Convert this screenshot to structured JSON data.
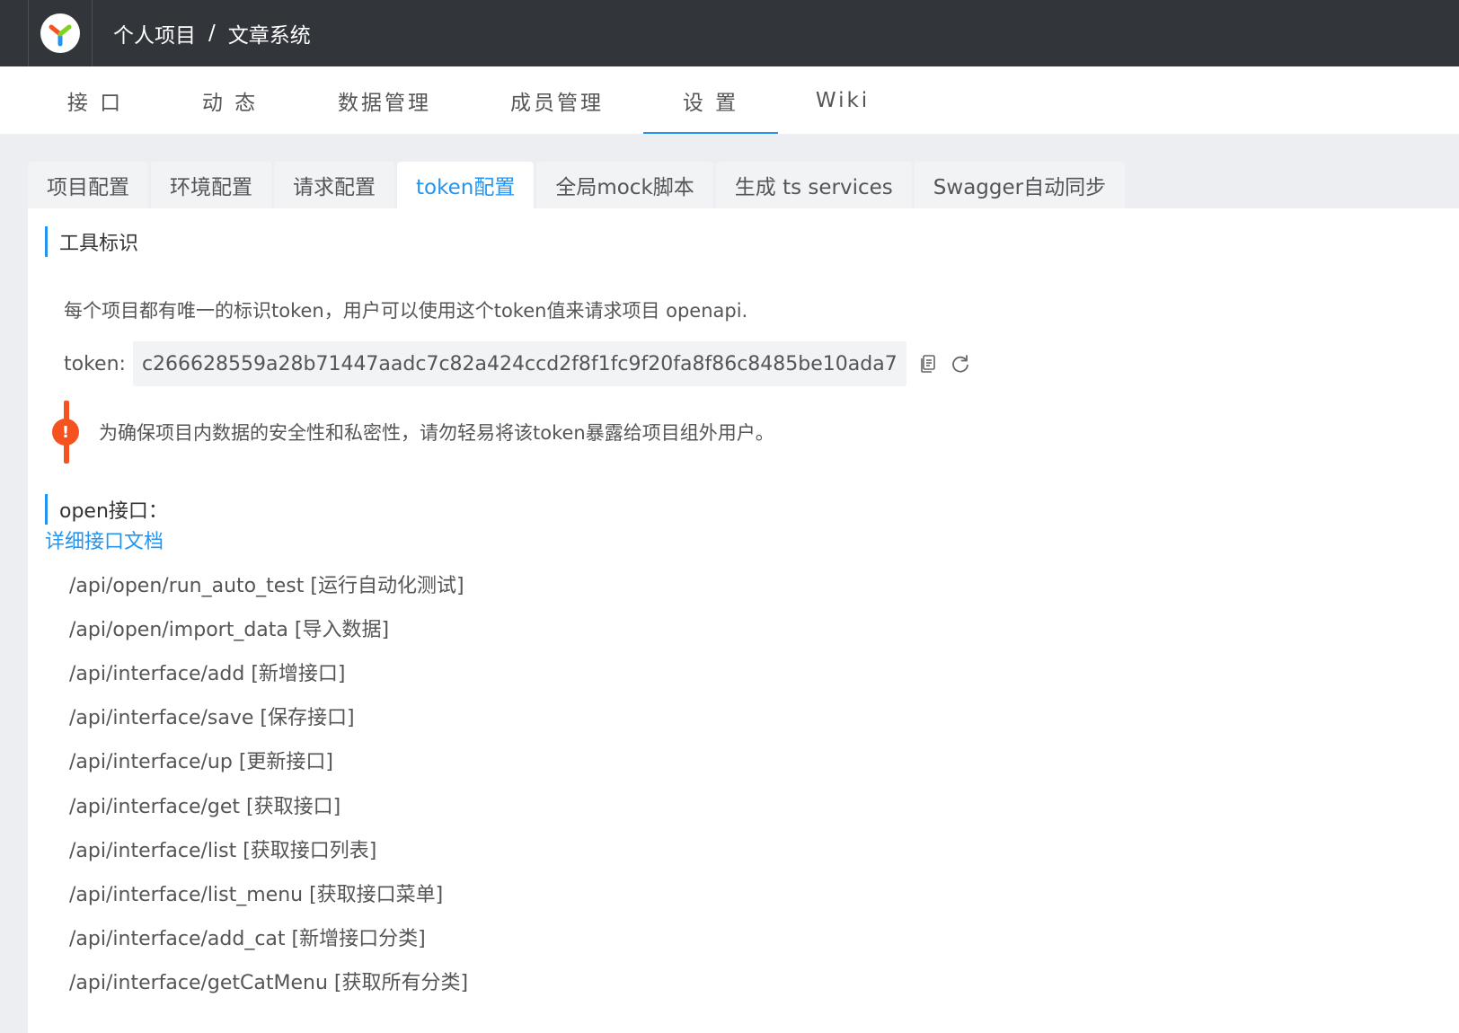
{
  "header": {
    "breadcrumb": [
      "个人项目",
      "/",
      "文章系统"
    ]
  },
  "nav": {
    "items": [
      {
        "label": "接 口"
      },
      {
        "label": "动 态"
      },
      {
        "label": "数据管理"
      },
      {
        "label": "成员管理"
      },
      {
        "label": "设 置"
      },
      {
        "label": "Wiki"
      }
    ],
    "active_index": 4
  },
  "tabs": [
    {
      "label": "项目配置"
    },
    {
      "label": "环境配置"
    },
    {
      "label": "请求配置"
    },
    {
      "label": "token配置"
    },
    {
      "label": "全局mock脚本"
    },
    {
      "label": "生成 ts services"
    },
    {
      "label": "Swagger自动同步"
    }
  ],
  "active_tab": 3,
  "token_section": {
    "title": "工具标识",
    "description": "每个项目都有唯一的标识token，用户可以使用这个token值来请求项目 openapi.",
    "token_label": "token:",
    "token_value": "c266628559a28b71447aadc7c82a424ccd2f8f1fc9f20fa8f86c8485be10ada7",
    "copy_icon": "copy-icon",
    "refresh_icon": "refresh-icon",
    "warning_mark": "!",
    "warning": "为确保项目内数据的安全性和私密性，请勿轻易将该token暴露给项目组外用户。"
  },
  "open_section": {
    "title": "open接口：",
    "doc_link": "详细接口文档",
    "apis": [
      "/api/open/run_auto_test [运行自动化测试]",
      "/api/open/import_data [导入数据]",
      "/api/interface/add [新增接口]",
      "/api/interface/save [保存接口]",
      "/api/interface/up [更新接口]",
      "/api/interface/get [获取接口]",
      "/api/interface/list [获取接口列表]",
      "/api/interface/list_menu [获取接口菜单]",
      "/api/interface/add_cat [新增接口分类]",
      "/api/interface/getCatMenu [获取所有分类]"
    ]
  },
  "colors": {
    "header_bg": "#32363a",
    "accent": "#2395f1",
    "warning": "#f5521f"
  }
}
